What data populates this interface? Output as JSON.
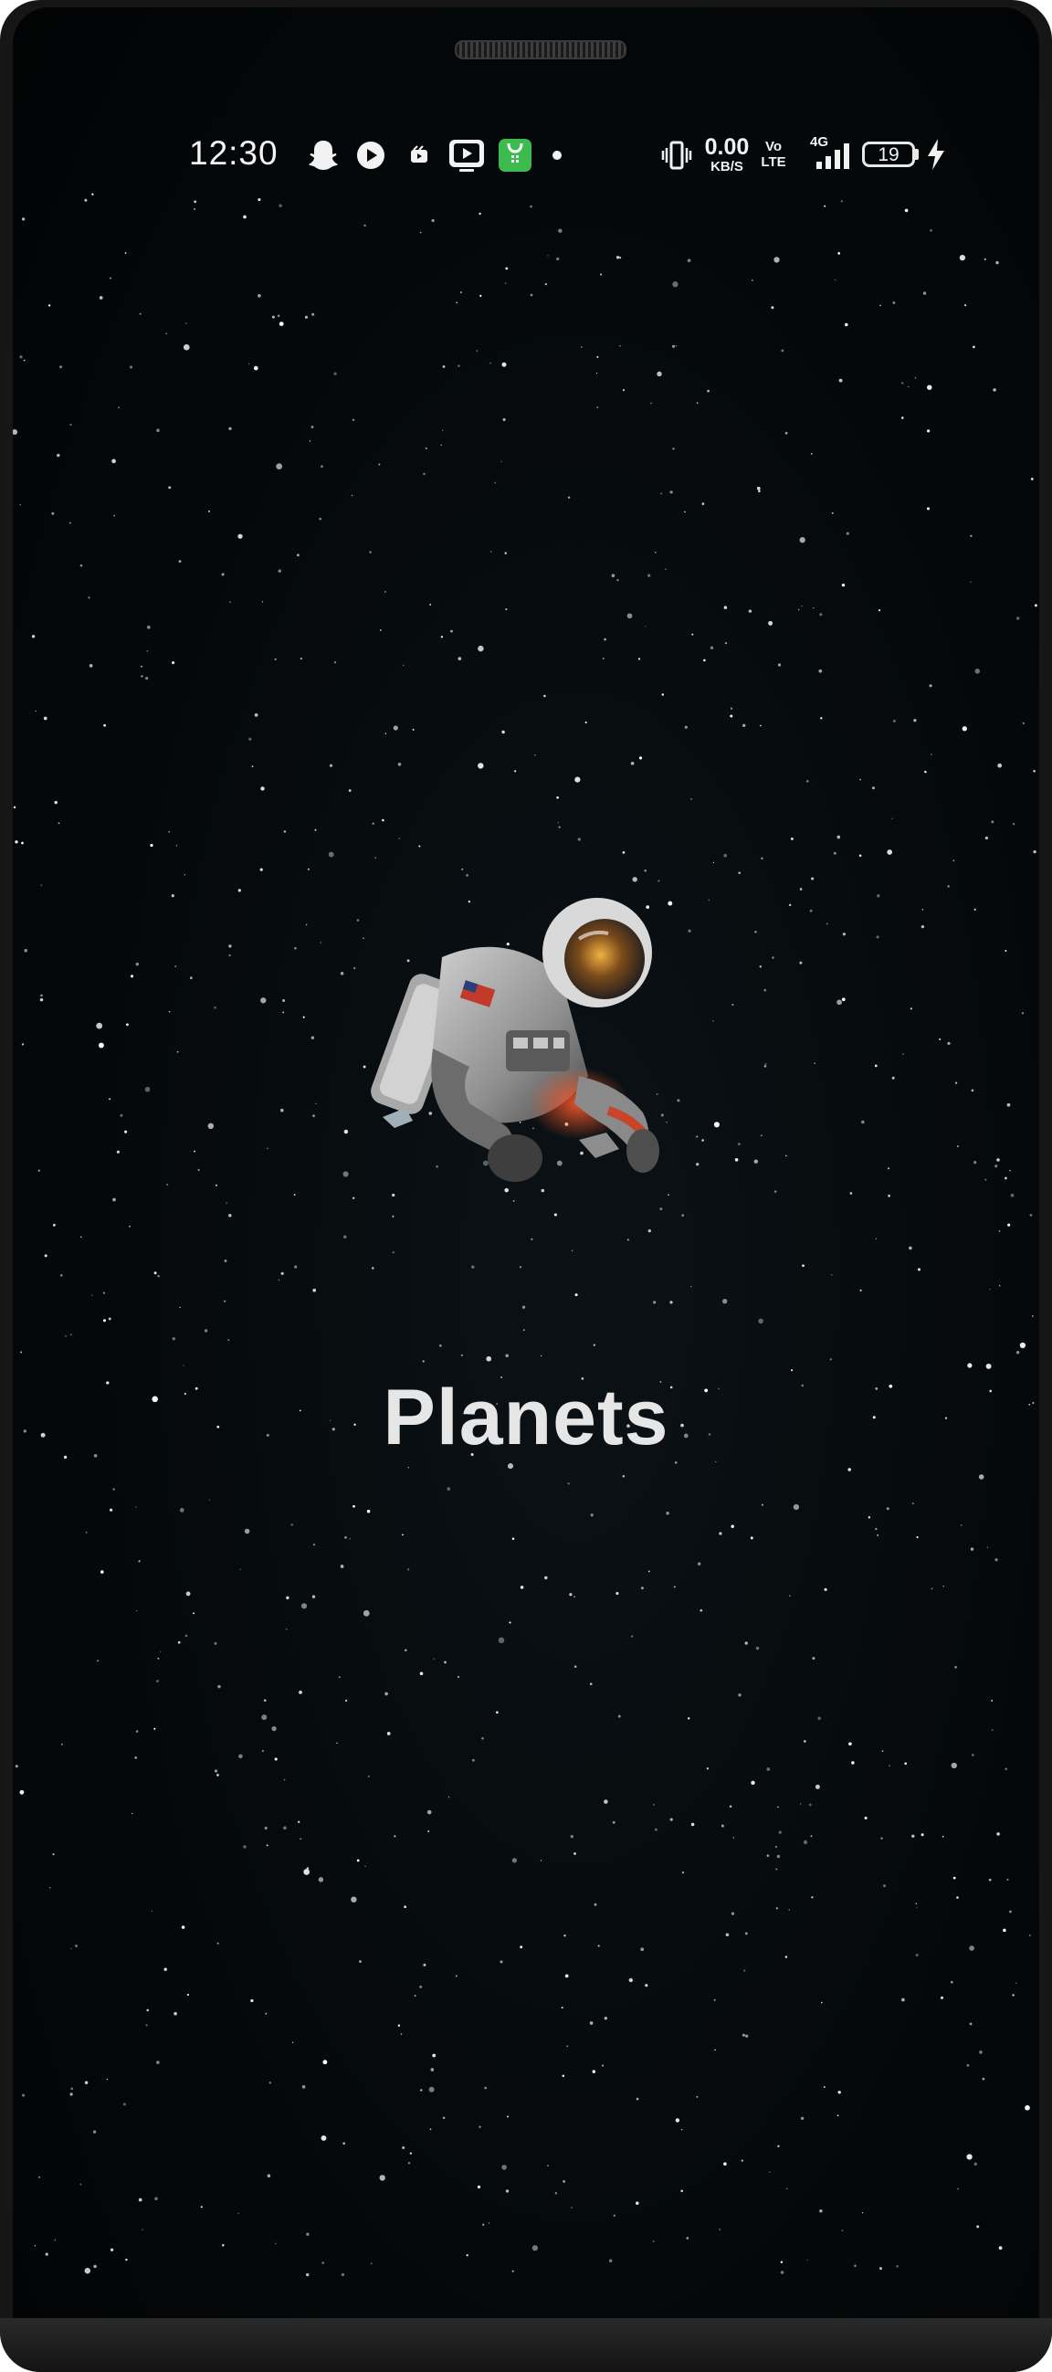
{
  "status_bar": {
    "time": "12:30",
    "notification_icons": [
      "snapchat-icon",
      "play-circle-icon",
      "shorts-icon",
      "youtube-tv-icon",
      "green-app-icon",
      "dot-icon"
    ],
    "net_speed_value": "0.00",
    "net_speed_unit": "KB/S",
    "volte_top": "Vo",
    "volte_bottom": "LTE",
    "network_type": "4G",
    "battery_level": "19",
    "charging": true,
    "colors": {
      "green_app": "#3dbb4f",
      "text": "#f2f2f2"
    }
  },
  "splash": {
    "title": "Planets",
    "illustration": "floating-astronaut-image",
    "background_color": "#05090b"
  }
}
